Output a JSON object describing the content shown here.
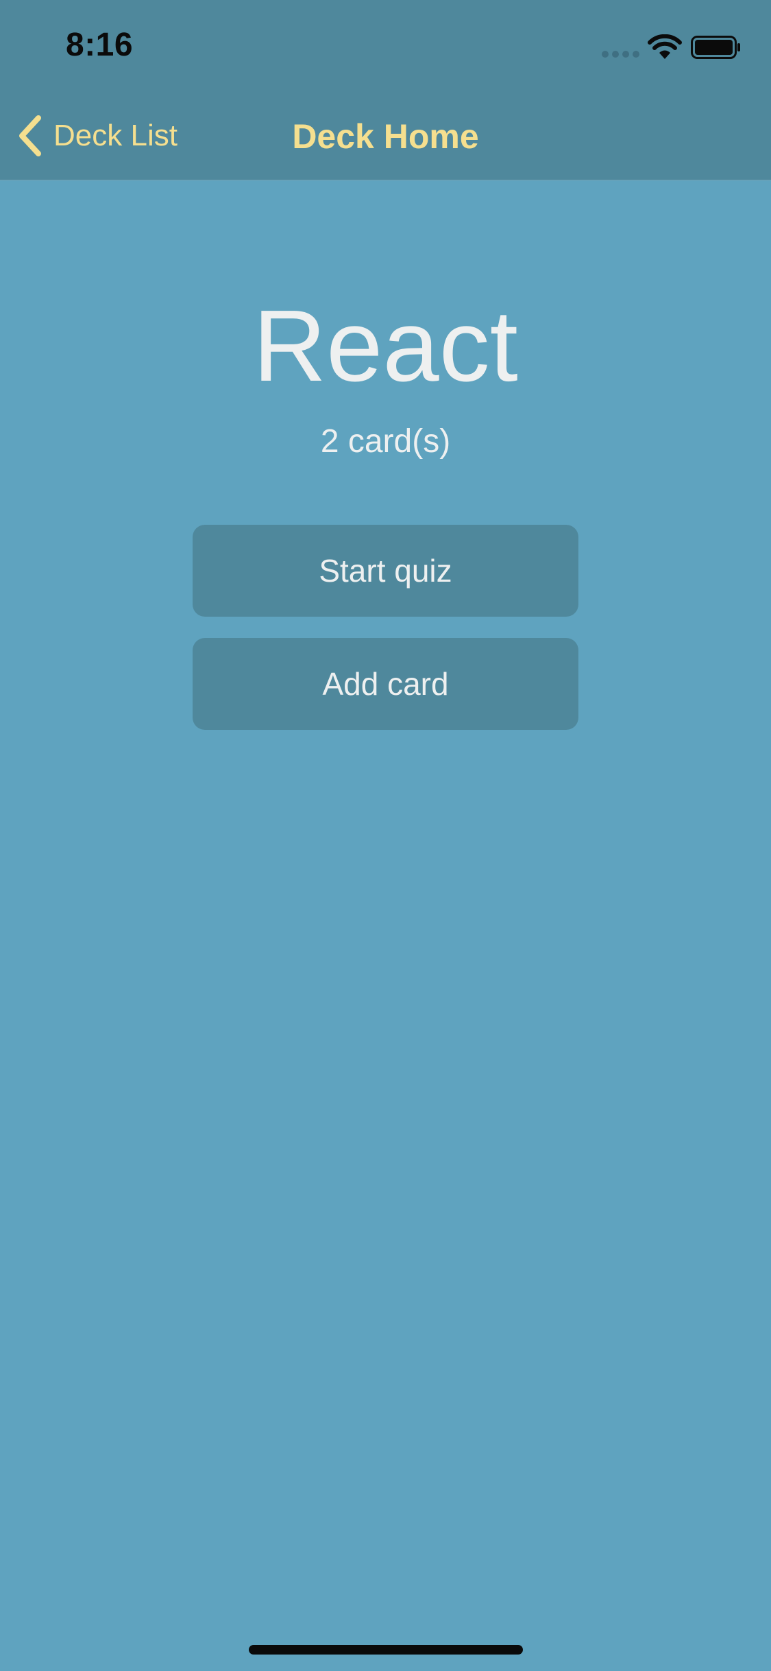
{
  "status_bar": {
    "time": "8:16",
    "icons": [
      "cellular-signal-icon",
      "wifi-icon",
      "battery-icon"
    ]
  },
  "nav": {
    "back_label": "Deck List",
    "back_icon": "chevron-left-icon",
    "title": "Deck Home"
  },
  "deck": {
    "title": "React",
    "card_count": "2 card(s)"
  },
  "actions": {
    "start_quiz": "Start quiz",
    "add_card": "Add card"
  },
  "colors": {
    "background": "#5fa3bf",
    "bar": "#4f889c",
    "accent": "#f5df8f",
    "text": "#eef0f0"
  }
}
